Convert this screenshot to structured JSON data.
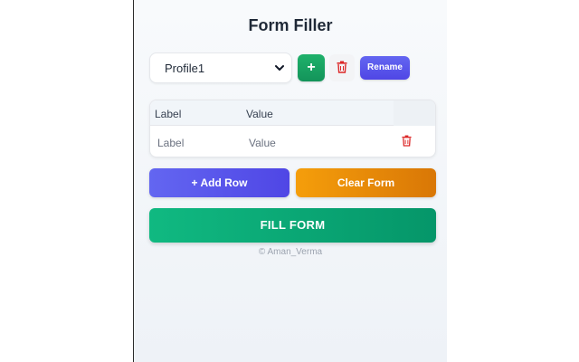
{
  "app": {
    "title": "Form Filler"
  },
  "profile": {
    "selected": "Profile1",
    "add_label": "+",
    "delete_icon": "trash-icon",
    "rename_label": "Rename"
  },
  "table": {
    "headers": {
      "label": "Label",
      "value": "Value"
    },
    "rows": [
      {
        "label_placeholder": "Label",
        "value_placeholder": "Value",
        "delete_icon": "trash-icon"
      }
    ]
  },
  "actions": {
    "add_row_label": "+ Add Row",
    "clear_label": "Clear Form",
    "fill_label": "FILL FORM"
  },
  "footer": {
    "credit": "© Aman_Verma"
  },
  "colors": {
    "indigo": "#4f46e5",
    "green": "#059669",
    "amber": "#d97706",
    "danger": "#dc2626"
  }
}
